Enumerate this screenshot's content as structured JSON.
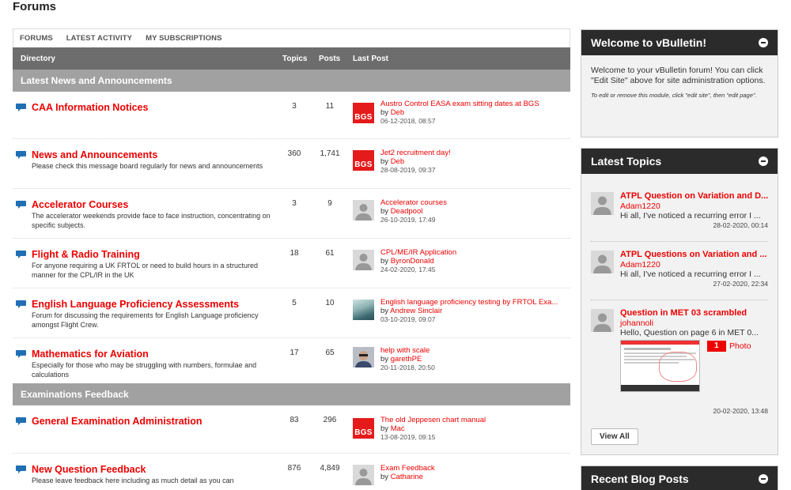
{
  "page": {
    "title": "Forums"
  },
  "tabs": [
    "FORUMS",
    "LATEST ACTIVITY",
    "MY SUBSCRIPTIONS"
  ],
  "columns": {
    "directory": "Directory",
    "topics": "Topics",
    "posts": "Posts",
    "last_post": "Last Post"
  },
  "sections": [
    {
      "title": "Latest News and Announcements"
    },
    {
      "title": "Examinations Feedback"
    }
  ],
  "forums": [
    {
      "title": "CAA Information Notices",
      "desc": "",
      "topics": "3",
      "posts": "11",
      "lp_thumb": "BGS",
      "lp_title": "Austro Control EASA exam sitting dates at BGS",
      "lp_by": "by",
      "lp_user": "Deb",
      "lp_date": "06-12-2018, 08:57"
    },
    {
      "title": "News and Announcements",
      "desc": "Please check this message board regularly for news and announcements",
      "topics": "360",
      "posts": "1,741",
      "lp_thumb": "BGS",
      "lp_title": "Jet2 recruitment day!",
      "lp_by": "by",
      "lp_user": "Deb",
      "lp_date": "28-08-2019, 09:37"
    },
    {
      "title": "Accelerator Courses",
      "desc": "The accelerator weekends provide face to face instruction, concentrating on specific subjects.",
      "topics": "3",
      "posts": "9",
      "lp_thumb": "",
      "lp_title": "Accelerator courses",
      "lp_by": "by",
      "lp_user": "Deadpool",
      "lp_date": "26-10-2019, 17:49"
    },
    {
      "title": "Flight & Radio Training",
      "desc": "For anyone requiring a UK FRTOL or need to build hours in a structured manner for the CPL/IR in the UK",
      "topics": "18",
      "posts": "61",
      "lp_thumb": "",
      "lp_title": "CPL/ME/IR Application",
      "lp_by": "by",
      "lp_user": "ByronDonald",
      "lp_date": "24-02-2020, 17:45"
    },
    {
      "title": "English Language Proficiency Assessments",
      "desc": "Forum for discussing the requirements for English Language proficiency amongst Flight Crew.",
      "topics": "5",
      "posts": "10",
      "lp_thumb": "",
      "lp_title": "English language proficiency testing by FRTOL Exa...",
      "lp_by": "by",
      "lp_user": "Andrew Sinclair",
      "lp_date": "03-10-2019, 09:07"
    },
    {
      "title": "Mathematics for Aviation",
      "desc": "Especially for those who may be struggling with numbers, formulae and calculations",
      "topics": "17",
      "posts": "65",
      "lp_thumb": "",
      "lp_title": "help with scale",
      "lp_by": "by",
      "lp_user": "garethPE",
      "lp_date": "20-11-2018, 20:50"
    },
    {
      "title": "General Examination Administration",
      "desc": "",
      "topics": "83",
      "posts": "296",
      "lp_thumb": "BGS",
      "lp_title": "The old Jeppesen chart manual",
      "lp_by": "by",
      "lp_user": "Mac",
      "lp_date": "13-08-2019, 09:15"
    },
    {
      "title": "New Question Feedback",
      "desc": "Please leave feedback here including as much detail as you can",
      "topics": "876",
      "posts": "4,849",
      "lp_thumb": "",
      "lp_title": "Exam Feedback",
      "lp_by": "by",
      "lp_user": "Catharine",
      "lp_date": ""
    }
  ],
  "sidebar": {
    "welcome": {
      "title": "Welcome to vBulletin!",
      "body": "Welcome to your vBulletin forum! You can click \"Edit Site\" above for site administration options.",
      "note": "To edit or remove this module, click \"edit site\", then \"edit page\"."
    },
    "latest_topics": {
      "title": "Latest Topics",
      "items": [
        {
          "title": "ATPL Question on Variation and D...",
          "user": "Adam1220",
          "snippet": "Hi all, I've noticed a recurring error I ...",
          "date": "28-02-2020, 00:14"
        },
        {
          "title": "ATPL Questions on Variation and ...",
          "user": "Adam1220",
          "snippet": "Hi all, I've noticed a recurring error I ...",
          "date": "27-02-2020, 22:34"
        },
        {
          "title": "Question in MET 03 scrambled",
          "user": "johannoli",
          "snippet": "Hello, Question on page 6 in MET 0...",
          "photo_count": "1",
          "photo_label": "Photo",
          "date": "20-02-2020, 13:48"
        }
      ],
      "view_all": "View All"
    },
    "blog": {
      "title": "Recent Blog Posts"
    }
  },
  "colors": {
    "accent": "#e00000",
    "header_dark": "#2b2b2b",
    "col_header": "#6d6d6d",
    "section": "#a1a1a1"
  }
}
